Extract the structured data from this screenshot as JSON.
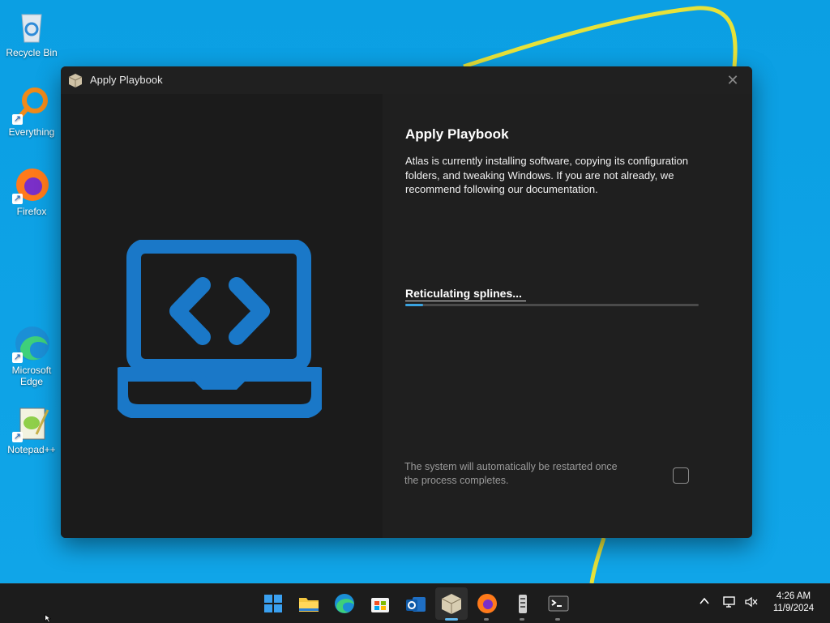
{
  "desktop": {
    "icons": [
      {
        "label": "Recycle Bin",
        "icon": "recycle-bin-icon"
      },
      {
        "label": "Everything",
        "icon": "everything-search-icon"
      },
      {
        "label": "Firefox",
        "icon": "firefox-icon"
      },
      {
        "label": "Microsoft Edge",
        "icon": "edge-icon"
      },
      {
        "label": "Notepad++",
        "icon": "notepadpp-icon"
      }
    ]
  },
  "window": {
    "title": "Apply Playbook",
    "close_glyph": "✕",
    "heading": "Apply Playbook",
    "description": "Atlas is currently installing software, copying its configuration folders, and tweaking Windows. If you are not already, we recommend following our documentation.",
    "status": "Reticulating splines...",
    "progress_fraction": 0.06,
    "restart_note": "The system will automatically be restarted once the process completes.",
    "restart_checked": false,
    "colors": {
      "accent": "#3aa3e0",
      "hero": "#1a78c8"
    }
  },
  "taskbar": {
    "apps": [
      "start-icon",
      "file-explorer-icon",
      "edge-icon",
      "microsoft-store-icon",
      "outlook-icon",
      "atlas-playbook-icon",
      "firefox-icon",
      "ameliorated-icon",
      "terminal-icon"
    ],
    "clock": {
      "time": "4:26 AM",
      "date": "11/9/2024"
    }
  }
}
